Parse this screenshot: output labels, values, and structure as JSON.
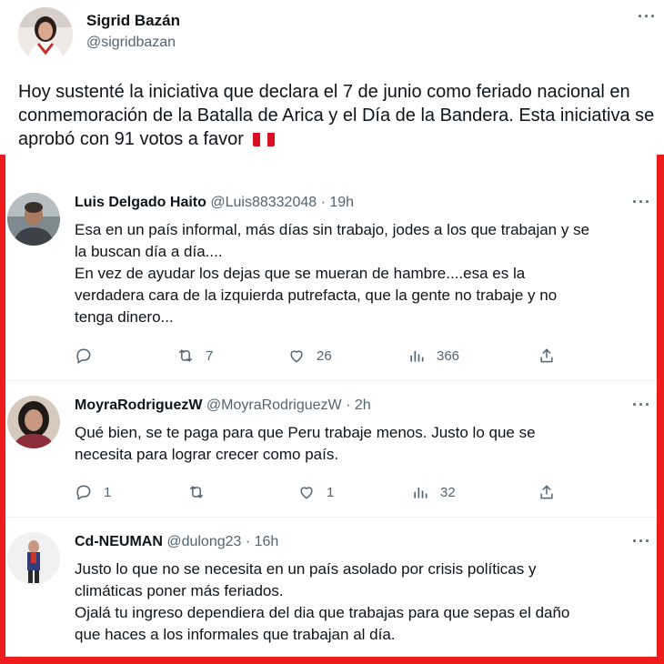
{
  "main_tweet": {
    "author_name": "Sigrid Bazán",
    "author_handle": "@sigridbazan",
    "text": "Hoy sustenté la iniciativa que declara el 7 de junio como feriado nacional en conmemoración de la Batalla de Arica y el Día de la Bandera. Esta iniciativa se aprobó con 91 votos a favor",
    "flag_icon": "peru-flag-icon",
    "more_label": "···"
  },
  "colors": {
    "frame": "#ee1b1b",
    "text": "#0f1419",
    "secondary": "#536471",
    "separator": "#eff3f4"
  },
  "replies": [
    {
      "name": "Luis Delgado Haito",
      "meta": "@Luis88332048 · 19h",
      "text_lines": [
        "Esa en un país informal, más días sin trabajo, jodes a los que trabajan y se",
        "la buscan día a día....",
        "En vez de ayudar los dejas que se mueran de hambre....esa es la",
        "verdadera cara de la izquierda putrefacta, que la gente no trabaje y no",
        "tenga dinero..."
      ],
      "reply_count": "",
      "retweet_count": "7",
      "like_count": "26",
      "view_count": "366"
    },
    {
      "name": "MoyraRodriguezW",
      "meta": "@MoyraRodriguezW · 2h",
      "text_lines": [
        "Qué bien, se te paga para que Peru trabaje menos. Justo lo que se",
        "necesita para lograr crecer como país."
      ],
      "reply_count": "1",
      "retweet_count": "",
      "like_count": "1",
      "view_count": "32"
    },
    {
      "name": "Cd-NEUMAN",
      "meta": "@dulong23 · 16h",
      "text_lines": [
        "Justo lo que no se necesita en un país asolado por crisis políticas y",
        "climáticas poner más feriados.",
        "Ojalá tu ingreso dependiera del dia que trabajas para que sepas el daño",
        "que haces a los informales que trabajan al día."
      ]
    }
  ]
}
